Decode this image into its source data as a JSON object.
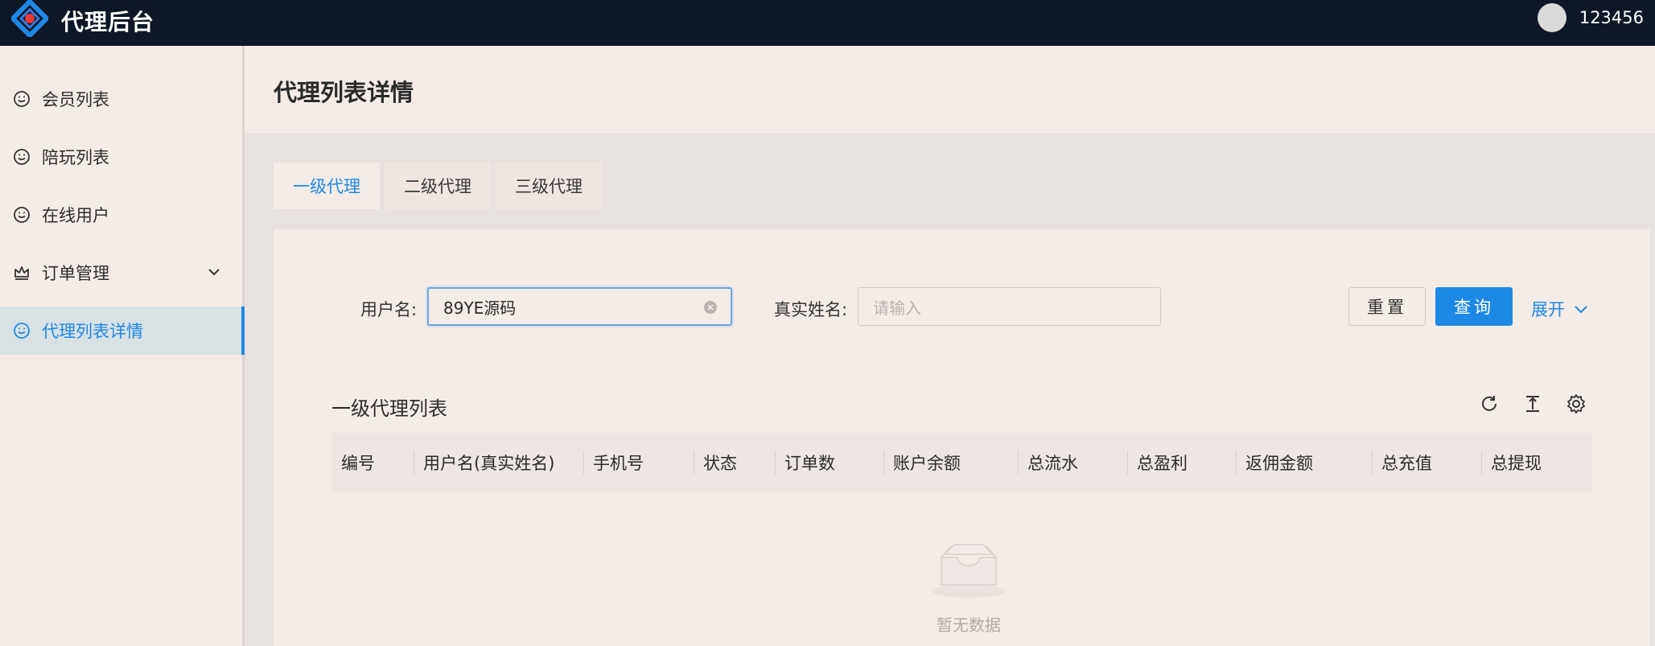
{
  "header": {
    "brand": "代理后台",
    "username": "123456",
    "logo_icon": "diamond-logo-icon",
    "avatar_icon": "user-avatar"
  },
  "sidebar": {
    "items": [
      {
        "label": "会员列表",
        "icon": "smile-icon"
      },
      {
        "label": "陪玩列表",
        "icon": "smile-icon"
      },
      {
        "label": "在线用户",
        "icon": "smile-icon"
      },
      {
        "label": "订单管理",
        "icon": "crown-icon",
        "has_submenu": true
      },
      {
        "label": "代理列表详情",
        "icon": "smile-icon",
        "active": true
      }
    ]
  },
  "page": {
    "title": "代理列表详情"
  },
  "tabs": [
    {
      "label": "一级代理",
      "active": true
    },
    {
      "label": "二级代理"
    },
    {
      "label": "三级代理"
    }
  ],
  "filter": {
    "username_label": "用户名:",
    "username_value": "89YE源码",
    "realname_label": "真实姓名:",
    "realname_placeholder": "请输入",
    "reset_label": "重置",
    "search_label": "查询",
    "expand_label": "展开"
  },
  "table": {
    "title": "一级代理列表",
    "columns": [
      "编号",
      "用户名(真实姓名)",
      "手机号",
      "状态",
      "订单数",
      "账户余额",
      "总流水",
      "总盈利",
      "返佣金额",
      "总充值",
      "总提现"
    ],
    "rows": [],
    "empty_text": "暂无数据",
    "tools": [
      "reload-icon",
      "column-height-icon",
      "setting-icon"
    ]
  },
  "colors": {
    "topbar": "#0e1726",
    "accent": "#1e88e5",
    "background": "#f5ece8"
  }
}
